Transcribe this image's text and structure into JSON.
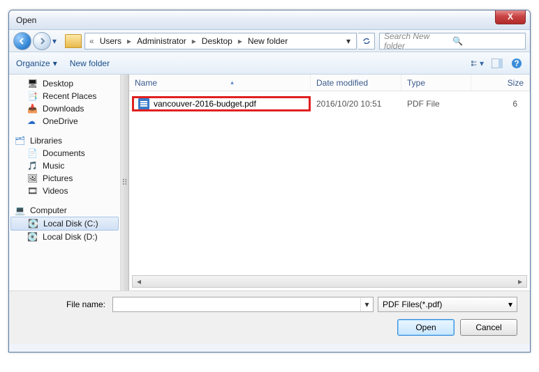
{
  "window": {
    "title": "Open"
  },
  "breadcrumb": {
    "segs": [
      "Users",
      "Administrator",
      "Desktop",
      "New folder"
    ]
  },
  "search": {
    "placeholder": "Search New folder"
  },
  "toolbar": {
    "organize": "Organize",
    "newfolder": "New folder"
  },
  "sidebar": {
    "fav": [
      "Desktop",
      "Recent Places",
      "Downloads",
      "OneDrive"
    ],
    "lib_label": "Libraries",
    "lib": [
      "Documents",
      "Music",
      "Pictures",
      "Videos"
    ],
    "comp_label": "Computer",
    "comp": [
      "Local Disk (C:)",
      "Local Disk (D:)"
    ]
  },
  "columns": {
    "name": "Name",
    "date": "Date modified",
    "type": "Type",
    "size": "Size"
  },
  "files": [
    {
      "name": "vancouver-2016-budget.pdf",
      "date": "2016/10/20 10:51",
      "type": "PDF File",
      "size": "6"
    }
  ],
  "bottom": {
    "filename_label": "File name:",
    "filename_value": "",
    "filter": "PDF Files(*.pdf)",
    "open": "Open",
    "cancel": "Cancel"
  }
}
